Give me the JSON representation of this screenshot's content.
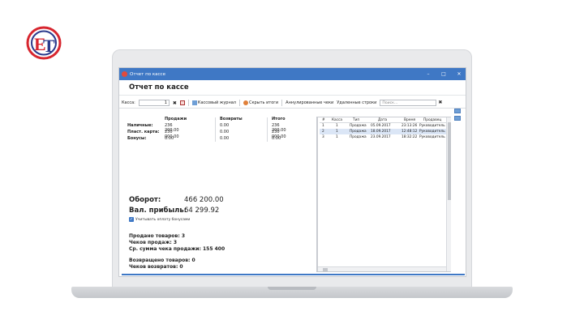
{
  "brand": {
    "logo_letters": "ET",
    "colors": {
      "red": "#d7262f",
      "blue": "#2a3a8c"
    }
  },
  "window": {
    "title": "Отчет по кассе",
    "minimize": "–",
    "maximize": "□",
    "close": "✕"
  },
  "heading": "Отчет по кассе",
  "toolbar": {
    "kassa_label": "Касса:",
    "kassa_value": "1",
    "journal": "Кассовый журнал",
    "hide_totals": "Скрыть итоги",
    "cancelled": "Аннулированные чеки",
    "deleted": "Удаленные строки",
    "search_placeholder": "Поиск..."
  },
  "summary": {
    "headers": [
      "Продажи",
      "Возвраты",
      "Итого"
    ],
    "rows": [
      {
        "label": "Наличные:",
        "sales": "236 200.00",
        "returns": "0.00",
        "total": "236 200.00"
      },
      {
        "label": "Пласт. карта:",
        "sales": "230 000.00",
        "returns": "0.00",
        "total": "230 000.00"
      },
      {
        "label": "Бонусы:",
        "sales": "0.00",
        "returns": "0.00",
        "total": "0.00"
      }
    ]
  },
  "turnover": {
    "label": "Оборот:",
    "value": "466 200.00"
  },
  "gross_profit": {
    "label": "Вал. прибыль:",
    "value": "64 299.92"
  },
  "bonus_checkbox": {
    "label": "Учитывать оплату бонусами",
    "checked": true
  },
  "stats": {
    "sold_items": "Продано товаров: 3",
    "sale_checks": "Чеков продаж: 3",
    "avg_check": "Ср. сумма чека продажи: 155 400",
    "returned_items": "Возвращено товаров: 0",
    "return_checks": "Чеков возвратов: 0"
  },
  "table": {
    "columns": [
      "#",
      "Касса",
      "Тип",
      "Дата",
      "Время",
      "Продавец"
    ],
    "rows": [
      [
        "1",
        "1",
        "Продажа",
        "05.09.2017",
        "23:13:26",
        "Руководитель"
      ],
      [
        "2",
        "1",
        "Продажа",
        "18.09.2017",
        "12:48:12",
        "Руководитель"
      ],
      [
        "3",
        "1",
        "Продажа",
        "23.09.2017",
        "18:32:22",
        "Руководитель"
      ]
    ],
    "selected_row": 1
  }
}
